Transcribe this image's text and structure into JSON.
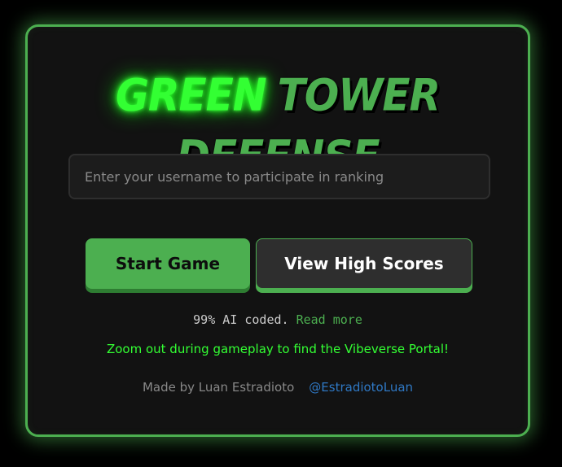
{
  "title": {
    "part1": "Green",
    "part2": "Tower Defense"
  },
  "username": {
    "placeholder": "Enter your username to participate in ranking",
    "value": ""
  },
  "buttons": {
    "start_label": "Start Game",
    "scores_label": "View High Scores"
  },
  "ai_note": {
    "text": "99% AI coded.",
    "link_label": "Read more"
  },
  "portal_hint": "Zoom out during gameplay to find the Vibeverse Portal!",
  "credits": {
    "made_by": "Made by Luan Estradioto",
    "handle": "@EstradiotoLuan"
  },
  "colors": {
    "accent": "#4caf50",
    "neon_green": "#33ff33",
    "panel_bg": "#121212",
    "page_bg": "#000000",
    "link_blue": "#2f78c4"
  }
}
